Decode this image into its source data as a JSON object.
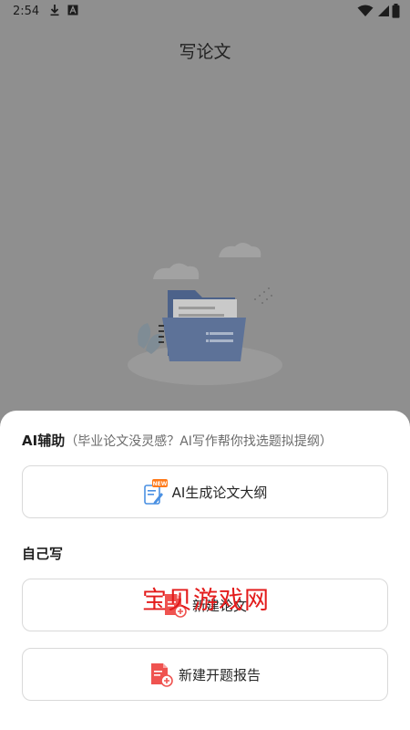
{
  "status_bar": {
    "time": "2:54",
    "icons": [
      "download-icon",
      "a-icon",
      "wifi-icon",
      "battery-icon"
    ]
  },
  "header": {
    "title": "写论文"
  },
  "sheet": {
    "ai_section": {
      "title": "AI辅助",
      "subtitle": "（毕业论文没灵感？AI写作帮你找选题拟提纲）"
    },
    "ai_button": {
      "label": "AI生成论文大纲",
      "badge": "NEW",
      "icon": "document-edit-icon"
    },
    "self_section": {
      "title": "自己写"
    },
    "new_paper_button": {
      "label": "新建论文",
      "icon": "new-document-icon"
    },
    "new_proposal_button": {
      "label": "新建开题报告",
      "icon": "new-document-icon"
    }
  },
  "watermark": {
    "text": "宝贝游戏网"
  },
  "colors": {
    "overlay": "#8f8f8f",
    "sheet": "#ffffff",
    "ai_icon_blue": "#4a90e2",
    "badge_orange": "#ff7a1a",
    "red_icon": "#ef5350",
    "watermark_red": "#e31b1b"
  }
}
